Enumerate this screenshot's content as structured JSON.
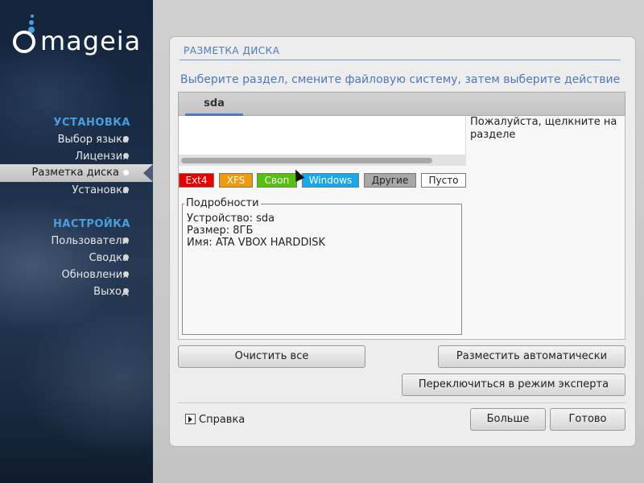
{
  "app": {
    "logo_text": "mageia"
  },
  "sidebar": {
    "section_install": "УСТАНОВКА",
    "section_settings": "НАСТРОЙКА",
    "install_items": [
      {
        "label": "Выбор языка"
      },
      {
        "label": "Лицензия"
      },
      {
        "label": "Разметка диска",
        "active": true
      },
      {
        "label": "Установка"
      }
    ],
    "settings_items": [
      {
        "label": "Пользователи"
      },
      {
        "label": "Сводка"
      },
      {
        "label": "Обновления"
      },
      {
        "label": "Выход"
      }
    ]
  },
  "panel": {
    "title": "РАЗМЕТКА ДИСКА",
    "instruction": "Выберите раздел, смените файловую систему, затем выберите действие",
    "disk_tab": "sda",
    "hint": "Пожалуйста, щелкните на разделе",
    "legend": [
      {
        "label": "Ext4",
        "color": "#e80000",
        "text_color": "#ffffff"
      },
      {
        "label": "XFS",
        "color": "#f09a10",
        "text_color": "#ffffff"
      },
      {
        "label": "Своп",
        "color": "#55c010",
        "text_color": "#ffffff"
      },
      {
        "label": "Windows",
        "color": "#18a8e8",
        "text_color": "#ffffff"
      },
      {
        "label": "Другие",
        "color": "#a8a8a8",
        "text_color": "#222222"
      },
      {
        "label": "Пусто",
        "color": "#ffffff",
        "text_color": "#222222"
      }
    ],
    "details": {
      "heading": "Подробности",
      "device": "Устройство: sda",
      "size": "Размер: 8ГБ",
      "name": "Имя: ATA VBOX HARDDISK"
    },
    "buttons": {
      "clear_all": "Очистить все",
      "auto_allocate": "Разместить автоматически",
      "expert_mode": "Переключиться в режим эксперта",
      "help": "Справка",
      "more": "Больше",
      "done": "Готово"
    }
  },
  "colors": {
    "accent": "#4a7ac0",
    "sidebar_heading": "#4a9ee0"
  }
}
